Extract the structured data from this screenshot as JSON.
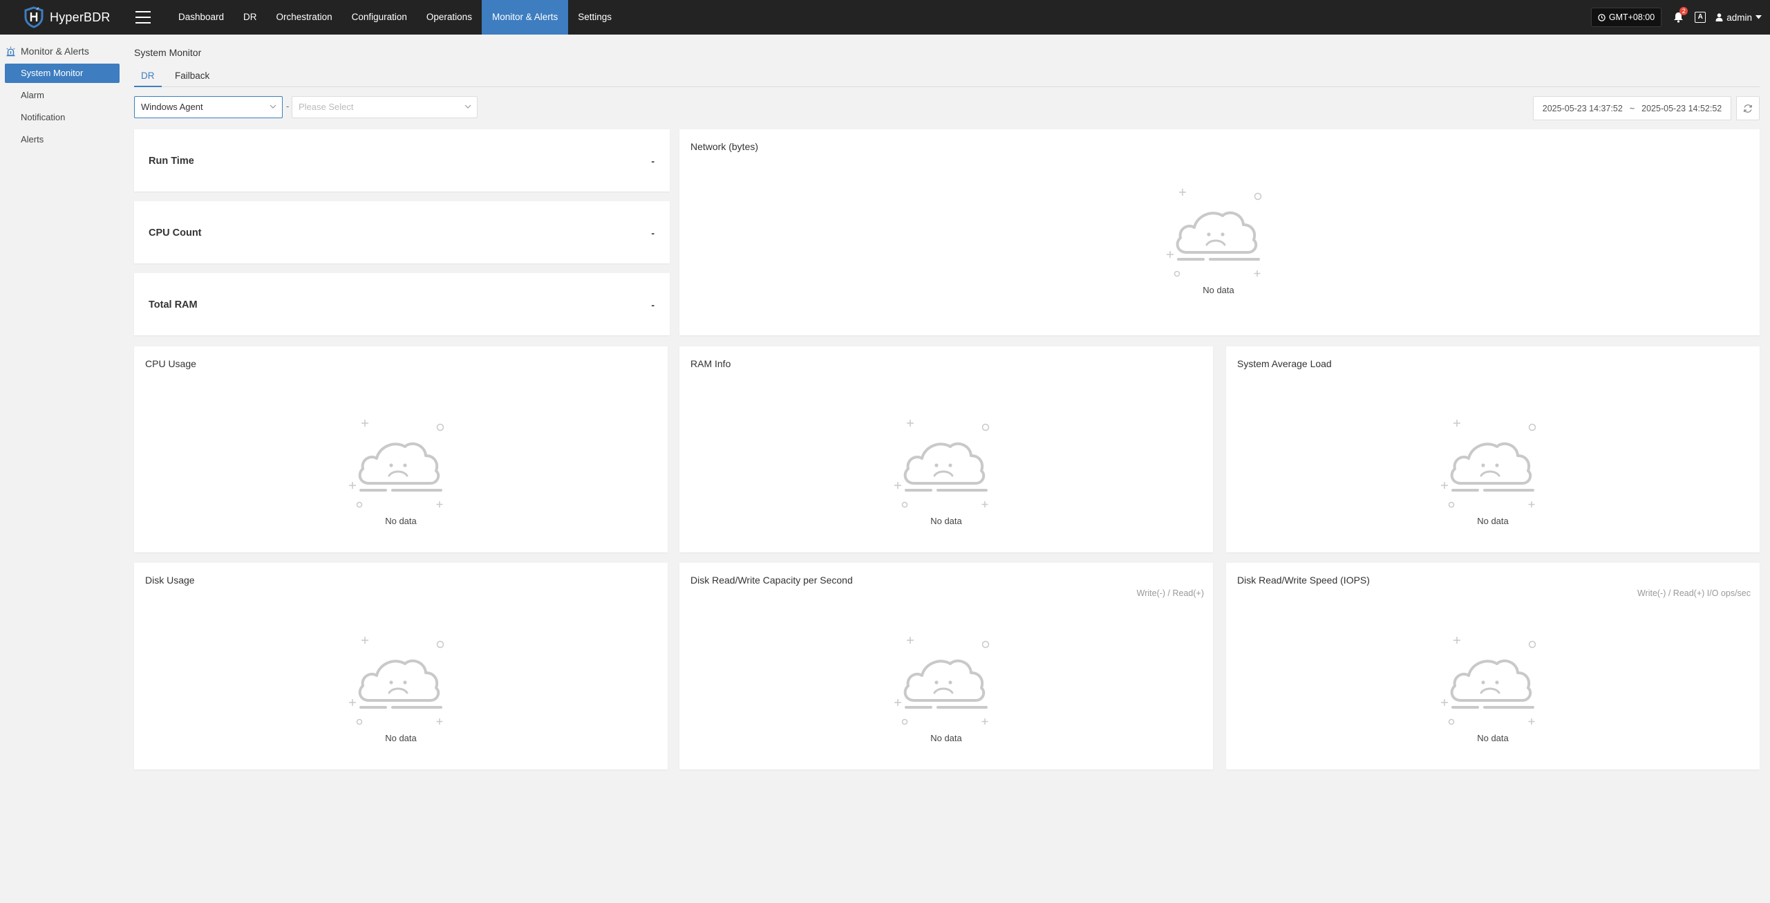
{
  "app": {
    "name": "HyperBDR"
  },
  "nav": {
    "items": [
      "Dashboard",
      "DR",
      "Orchestration",
      "Configuration",
      "Operations",
      "Monitor & Alerts",
      "Settings"
    ],
    "active": "Monitor & Alerts"
  },
  "topbar": {
    "timezone": "GMT+08:00",
    "notification_count": "2",
    "language_icon": "A",
    "user": "admin"
  },
  "sidebar": {
    "section_title": "Monitor & Alerts",
    "items": [
      "System Monitor",
      "Alarm",
      "Notification",
      "Alerts"
    ],
    "active": "System Monitor"
  },
  "page": {
    "title": "System Monitor",
    "tabs": [
      "DR",
      "Failback"
    ],
    "active_tab": "DR"
  },
  "filters": {
    "agent_type": "Windows Agent",
    "host_placeholder": "Please Select",
    "separator": "-",
    "date_start": "2025-05-23 14:37:52",
    "date_sep": "~",
    "date_end": "2025-05-23 14:52:52"
  },
  "stats": [
    {
      "label": "Run Time",
      "value": "-"
    },
    {
      "label": "CPU Count",
      "value": "-"
    },
    {
      "label": "Total RAM",
      "value": "-"
    }
  ],
  "charts": {
    "network": {
      "title": "Network (bytes)",
      "empty": "No data"
    },
    "cpu_usage": {
      "title": "CPU Usage",
      "empty": "No data"
    },
    "ram_info": {
      "title": "RAM Info",
      "empty": "No data"
    },
    "system_load": {
      "title": "System Average Load",
      "empty": "No data"
    },
    "disk_usage": {
      "title": "Disk Usage",
      "empty": "No data"
    },
    "disk_capacity": {
      "title": "Disk Read/Write Capacity per Second",
      "note": "Write(-) / Read(+)",
      "empty": "No data"
    },
    "disk_iops": {
      "title": "Disk Read/Write Speed (IOPS)",
      "note": "Write(-) / Read(+) I/O ops/sec",
      "empty": "No data"
    }
  },
  "colors": {
    "accent": "#3d7dc0",
    "topbar": "#232323",
    "background": "#f2f2f2",
    "empty_icon": "#c9c9c9"
  }
}
